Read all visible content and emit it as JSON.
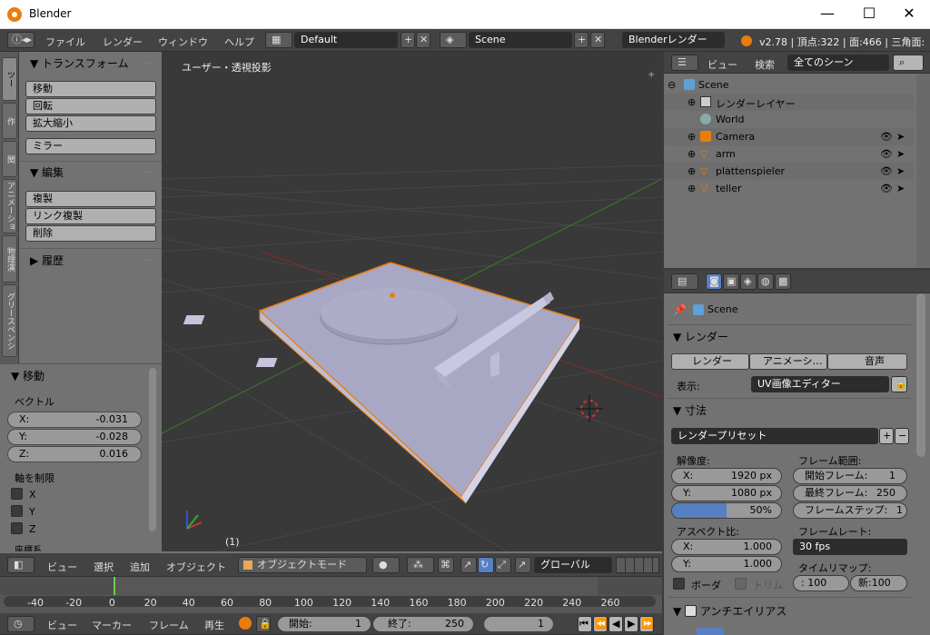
{
  "window": {
    "title": "Blender",
    "minimize": "—",
    "maximize": "☐",
    "close": "✕"
  },
  "topbar": {
    "menus": [
      "ファイル",
      "レンダー",
      "ウィンドウ",
      "ヘルプ"
    ],
    "layout": "Default",
    "scene": "Scene",
    "engine": "Blenderレンダー",
    "stats": "v2.78 | 頂点:322 | 面:466 | 三角面:"
  },
  "tabs": [
    "ツー",
    "作",
    "関",
    "アニメーショ",
    "物理演",
    "グリースペンシ"
  ],
  "toolshelf": {
    "transform_title": "トランスフォーム",
    "transform_buttons": [
      "移動",
      "回転",
      "拡大縮小"
    ],
    "mirror": "ミラー",
    "edit_title": "編集",
    "edit_buttons": [
      "複製",
      "リンク複製",
      "削除"
    ],
    "history_title": "履歴"
  },
  "redo": {
    "title": "移動",
    "vector_label": "ベクトル",
    "x_label": "X:",
    "x": "-0.031",
    "y_label": "Y:",
    "y": "-0.028",
    "z_label": "Z:",
    "z": "0.016",
    "constraint_label": "軸を制限",
    "axes": [
      "X",
      "Y",
      "Z"
    ],
    "coord_label": "座標系"
  },
  "viewport": {
    "view_label": "ユーザー・透視投影",
    "frame_label": "(1)"
  },
  "outliner": {
    "menus": [
      "ビュー",
      "検索"
    ],
    "filter": "全てのシーン",
    "items": [
      {
        "name": "Scene",
        "indent": 0
      },
      {
        "name": "レンダーレイヤー",
        "indent": 1
      },
      {
        "name": "World",
        "indent": 1
      },
      {
        "name": "Camera",
        "indent": 1
      },
      {
        "name": "arm",
        "indent": 1
      },
      {
        "name": "plattenspieler",
        "indent": 1
      },
      {
        "name": "teller",
        "indent": 1
      }
    ]
  },
  "props": {
    "scene": "Scene",
    "render_title": "レンダー",
    "render_tabs": [
      "レンダー",
      "アニメーシ…",
      "音声"
    ],
    "display_label": "表示:",
    "display_value": "UV画像エディター",
    "dimensions_title": "寸法",
    "preset": "レンダープリセット",
    "resolution_label": "解像度:",
    "res_x_label": "X:",
    "res_x": "1920 px",
    "res_y_label": "Y:",
    "res_y": "1080 px",
    "res_pct": "50%",
    "res_fill": 0.5,
    "frame_range_label": "フレーム範囲:",
    "start_label": "開始フレーム:",
    "start": "1",
    "end_label": "最終フレーム:",
    "end": "250",
    "step_label": "フレームステップ:",
    "step": "1",
    "aspect_label": "アスペクト比:",
    "asp_x_label": "X:",
    "asp_x": "1.000",
    "asp_y_label": "Y:",
    "asp_y": "1.000",
    "framerate_label": "フレームレート:",
    "framerate": "30 fps",
    "remap_label": "タイムリマップ:",
    "remap_old": ":  100",
    "remap_new": "新:100",
    "border": "ボーダ",
    "crop": "トリム",
    "aa_title": "アンチエイリアス"
  },
  "vphdr": {
    "menus": [
      "ビュー",
      "選択",
      "追加",
      "オブジェクト"
    ],
    "mode": "オブジェクトモード",
    "orientation": "グローバル"
  },
  "timeline": {
    "ticks": [
      "-40",
      "-20",
      "0",
      "20",
      "40",
      "60",
      "80",
      "100",
      "120",
      "140",
      "160",
      "180",
      "200",
      "220",
      "240",
      "260"
    ]
  },
  "tlhdr": {
    "menus": [
      "ビュー",
      "マーカー",
      "フレーム",
      "再生"
    ],
    "start_label": "開始:",
    "start": "1",
    "end_label": "終了:",
    "end": "250",
    "current": "1"
  },
  "colors": {
    "accent": "#e87d0d",
    "selected": "#5680c2",
    "xaxis": "#8a2a2a",
    "yaxis": "#3f7a2a"
  }
}
